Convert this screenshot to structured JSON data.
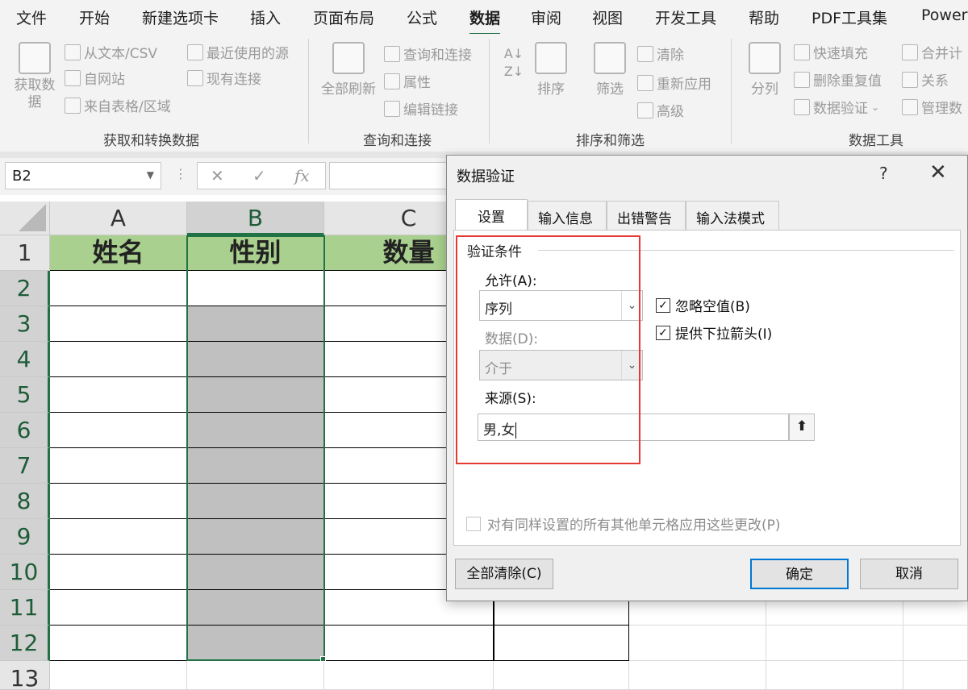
{
  "ribbon_tabs": [
    "文件",
    "开始",
    "新建选项卡",
    "插入",
    "页面布局",
    "公式",
    "数据",
    "审阅",
    "视图",
    "开发工具",
    "帮助",
    "PDF工具集",
    "Power"
  ],
  "active_tab": "数据",
  "ribbon": {
    "get_data": "获取数\n据",
    "from_text": "从文本/CSV",
    "from_web": "自网站",
    "from_table": "来自表格/区域",
    "recent_sources": "最近使用的源",
    "existing_conn": "现有连接",
    "group_get_transform": "获取和转换数据",
    "refresh_all": "全部刷新",
    "queries_conn": "查询和连接",
    "properties": "属性",
    "edit_links": "编辑链接",
    "group_queries": "查询和连接",
    "sort": "排序",
    "filter": "筛选",
    "clear": "清除",
    "reapply": "重新应用",
    "advanced": "高级",
    "group_sort_filter": "排序和筛选",
    "text_to_columns": "分列",
    "flash_fill": "快速填充",
    "remove_dup": "删除重复值",
    "data_validation": "数据验证",
    "consolidate": "合并计",
    "relationships": "关系",
    "manage_model": "管理数",
    "group_data_tools": "数据工具"
  },
  "formula_bar": {
    "name_box": "B2",
    "cancel": "✕",
    "enter": "✓",
    "fx": "fx"
  },
  "columns": [
    "A",
    "B",
    "C"
  ],
  "rows": [
    "1",
    "2",
    "3",
    "4",
    "5",
    "6",
    "7",
    "8",
    "9",
    "10",
    "11",
    "12",
    "13"
  ],
  "header_cells": [
    "姓名",
    "性别",
    "数量"
  ],
  "dialog": {
    "title": "数据验证",
    "help": "?",
    "close": "✕",
    "tabs": [
      "设置",
      "输入信息",
      "出错警告",
      "输入法模式"
    ],
    "group_title": "验证条件",
    "allow_label": "允许(A):",
    "allow_value": "序列",
    "data_label": "数据(D):",
    "data_value": "介于",
    "ignore_blank": "忽略空值(B)",
    "dropdown_arrow": "提供下拉箭头(I)",
    "source_label": "来源(S):",
    "source_value": "男,女",
    "apply_all": "对有同样设置的所有其他单元格应用这些更改(P)",
    "clear_all": "全部清除(C)",
    "ok": "确定",
    "cancel": "取消"
  }
}
